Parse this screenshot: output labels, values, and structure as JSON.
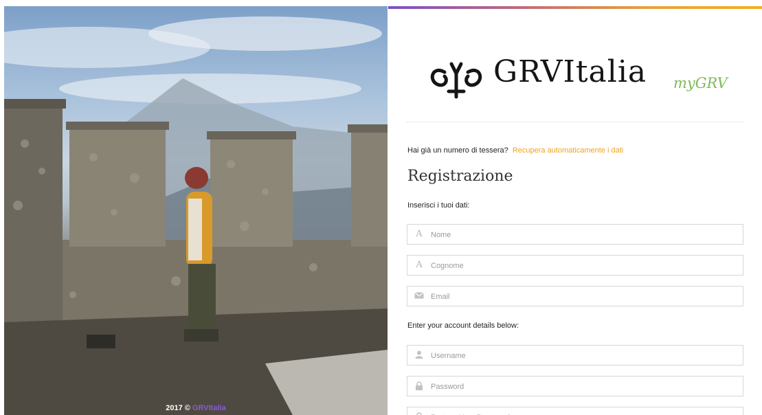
{
  "photo": {
    "credit_year": "2017 ©",
    "credit_link": "GRVItalia"
  },
  "brand": {
    "name": "GRVItalia",
    "subtitle": "myGRV",
    "accent_color": "#f0a21e",
    "subtitle_color": "#7fb85a"
  },
  "form": {
    "hint_text": "Hai già un numero di tessera?",
    "hint_link": "Recupera automaticamente i dati",
    "title": "Registrazione",
    "section1_label": "Inserisci i tuoi dati:",
    "fields1": [
      {
        "placeholder": "Nome",
        "icon": "font-icon",
        "value": ""
      },
      {
        "placeholder": "Cognome",
        "icon": "font-icon",
        "value": ""
      },
      {
        "placeholder": "Email",
        "icon": "envelope-icon",
        "value": ""
      }
    ],
    "section2_label": "Enter your account details below:",
    "fields2": [
      {
        "placeholder": "Username",
        "icon": "user-icon",
        "value": ""
      },
      {
        "placeholder": "Password",
        "icon": "lock-icon",
        "value": ""
      },
      {
        "placeholder": "Re-type Your Password",
        "icon": "lock-icon",
        "value": ""
      }
    ]
  }
}
